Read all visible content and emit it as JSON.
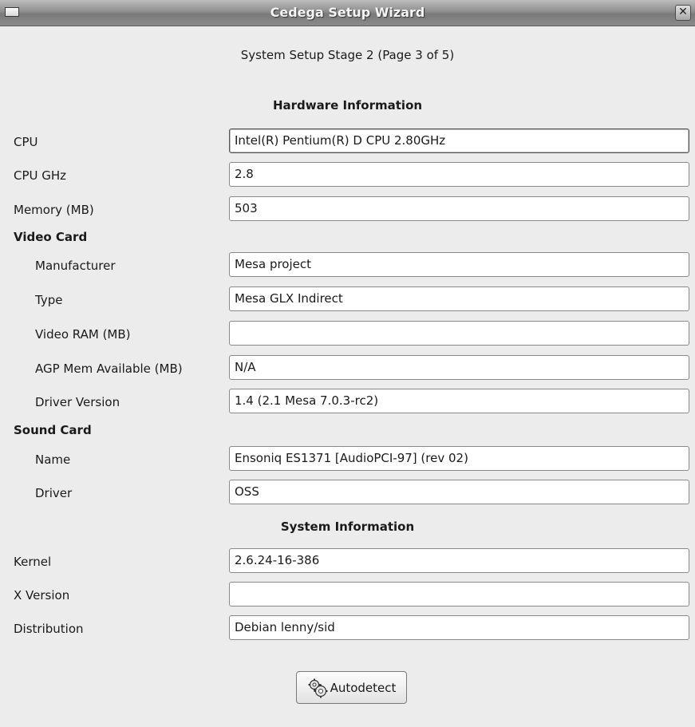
{
  "window": {
    "title": "Cedega Setup Wizard"
  },
  "stage": "System Setup Stage 2 (Page 3 of 5)",
  "hardware": {
    "heading": "Hardware Information",
    "cpu": {
      "label": "CPU",
      "value": "Intel(R) Pentium(R) D CPU 2.80GHz"
    },
    "cpu_ghz": {
      "label": "CPU GHz",
      "value": "2.8"
    },
    "memory": {
      "label": "Memory (MB)",
      "value": "503"
    },
    "video_card": {
      "heading": "Video Card",
      "manufacturer": {
        "label": "Manufacturer",
        "value": "Mesa project"
      },
      "type": {
        "label": "Type",
        "value": "Mesa GLX Indirect"
      },
      "video_ram": {
        "label": "Video RAM (MB)",
        "value": ""
      },
      "agp_mem": {
        "label": "AGP Mem Available (MB)",
        "value": "N/A"
      },
      "driver_version": {
        "label": "Driver Version",
        "value": "1.4 (2.1 Mesa 7.0.3-rc2)"
      }
    },
    "sound_card": {
      "heading": "Sound Card",
      "name": {
        "label": "Name",
        "value": "Ensoniq ES1371 [AudioPCI-97] (rev 02)"
      },
      "driver": {
        "label": "Driver",
        "value": "OSS"
      }
    }
  },
  "system": {
    "heading": "System Information",
    "kernel": {
      "label": "Kernel",
      "value": "2.6.24-16-386"
    },
    "x_version": {
      "label": "X Version",
      "value": ""
    },
    "distribution": {
      "label": "Distribution",
      "value": "Debian lenny/sid"
    }
  },
  "buttons": {
    "autodetect": "Autodetect"
  },
  "icons": {
    "window_menu": "window-menu-icon",
    "close": "close-icon",
    "autodetect": "gears-icon"
  }
}
